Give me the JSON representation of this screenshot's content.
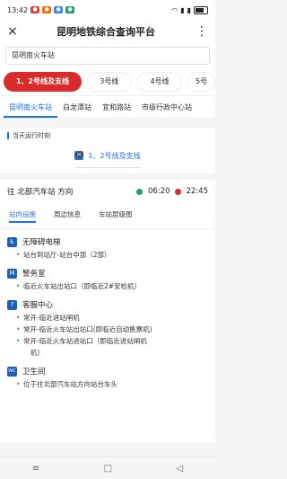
{
  "status": {
    "time": "13:42",
    "battery_level": 0.75
  },
  "titlebar": {
    "title": "昆明地铁综合查询平台",
    "close_icon": "×",
    "more_icon": "⋮"
  },
  "search": {
    "value": "昆明南火车站"
  },
  "lines": [
    {
      "label": "1、2号线及支线",
      "active": true
    },
    {
      "label": "3号线"
    },
    {
      "label": "4号线"
    },
    {
      "label": "5号"
    }
  ],
  "stations": [
    {
      "label": "昆明南火车站",
      "active": true
    },
    {
      "label": "白龙潭站"
    },
    {
      "label": "宜和路站"
    },
    {
      "label": "市级行政中心站"
    }
  ],
  "section": {
    "title": "当天运行时刻"
  },
  "line_label": {
    "text": "1、2号线及支线",
    "icon": "🚇"
  },
  "direction": {
    "text": "往 北部汽车站 方向",
    "first_time": "06:20",
    "last_time": "22:45"
  },
  "subtabs": [
    {
      "label": "站内设施",
      "active": true
    },
    {
      "label": "周边信息"
    },
    {
      "label": "车站层级图"
    }
  ],
  "facilities": [
    {
      "icon": "♿",
      "title": "无障碍电梯",
      "items": [
        "站台到站厅-站台中部（2部）"
      ]
    },
    {
      "icon": "M",
      "title": "警务室",
      "items": [
        "临近火车站出站口（即临近2#安检机）"
      ]
    },
    {
      "icon": "?",
      "title": "客服中心",
      "items": [
        "常开-临近进站闸机",
        "常开-临近火车站出站口(即临近自动售票机)",
        "常开-临近火车站进站口（即临近进站闸机"
      ]
    },
    {
      "icon": "WC",
      "title": "卫生间",
      "items": [
        "位于往北部汽车站方向站台车头"
      ]
    }
  ],
  "facility_continuations": {
    "f2_i2": "机）"
  },
  "bottombar": {
    "menu_icon": "≡",
    "home_icon": "□",
    "back_icon": "◁"
  }
}
